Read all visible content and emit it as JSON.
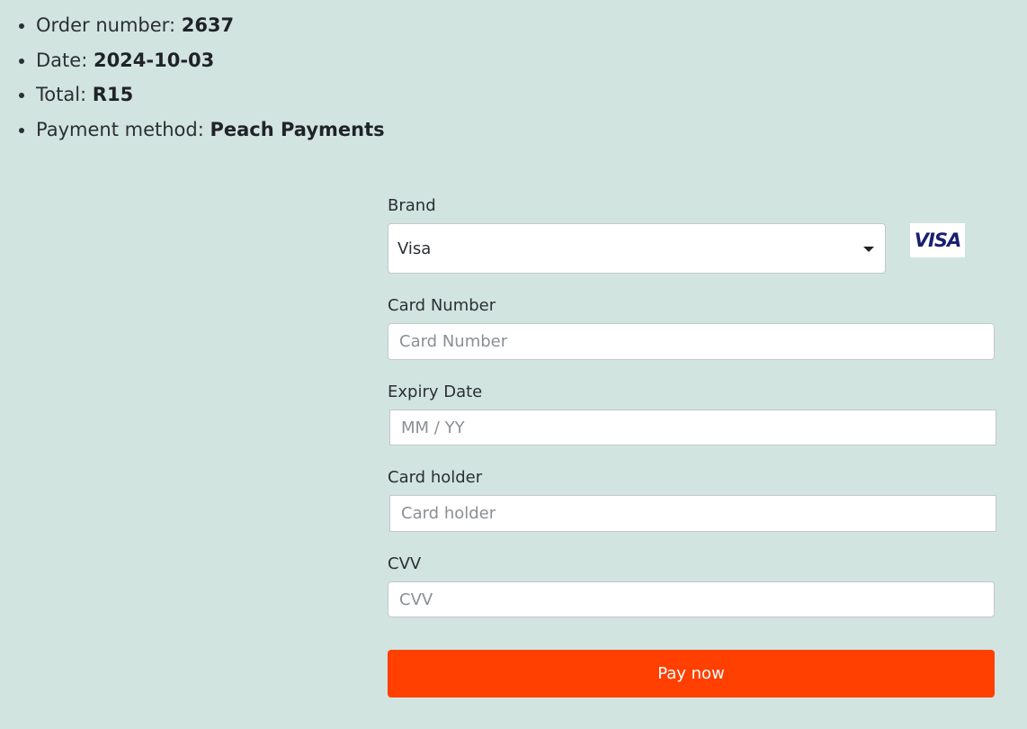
{
  "order": {
    "items": [
      {
        "label": "Order number: ",
        "value": "2637"
      },
      {
        "label": "Date: ",
        "value": "2024-10-03"
      },
      {
        "label": "Total: ",
        "value": "R15"
      },
      {
        "label": "Payment method: ",
        "value": "Peach Payments"
      }
    ]
  },
  "form": {
    "brand": {
      "label": "Brand",
      "selected": "Visa",
      "logo_text": "VISA",
      "logo_icon": "visa-logo-icon"
    },
    "card_number": {
      "label": "Card Number",
      "placeholder": "Card Number"
    },
    "expiry": {
      "label": "Expiry Date",
      "placeholder": "MM / YY"
    },
    "holder": {
      "label": "Card holder",
      "placeholder": "Card holder"
    },
    "cvv": {
      "label": "CVV",
      "placeholder": "CVV"
    },
    "submit_label": "Pay now"
  },
  "colors": {
    "background": "#d2e4df",
    "pay_button": "#ff4000",
    "visa_blue": "#1a1f71"
  }
}
